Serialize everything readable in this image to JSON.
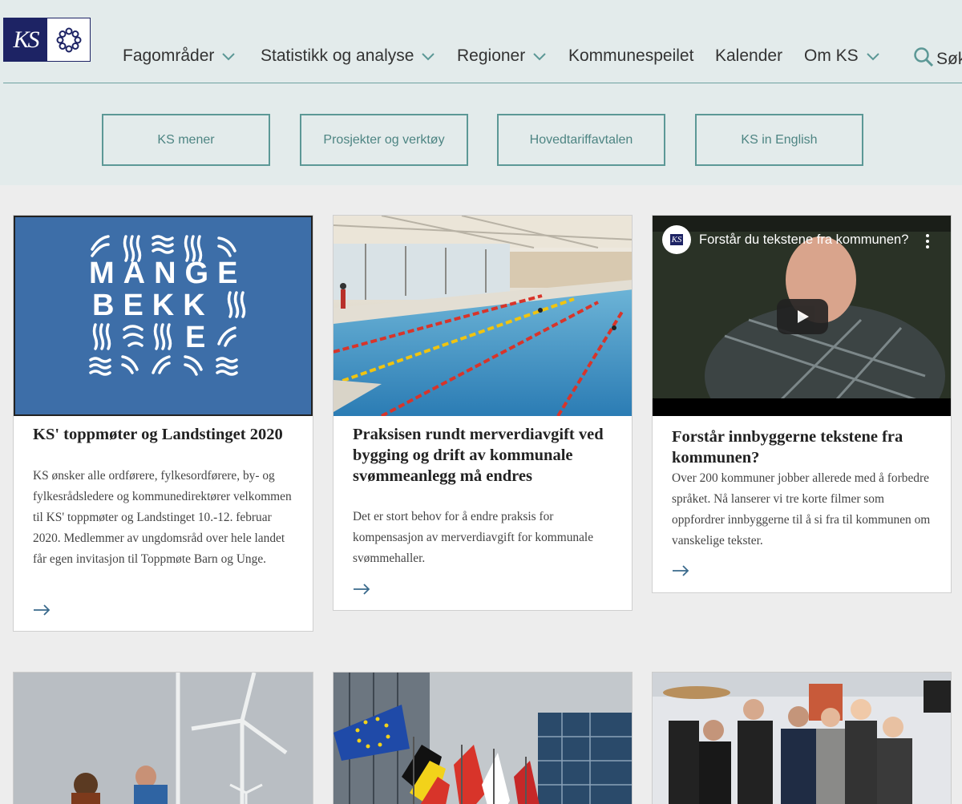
{
  "header": {
    "logo_text": "KS",
    "nav": [
      {
        "label": "Fagområder",
        "has_dropdown": true
      },
      {
        "label": "Statistikk og analyse",
        "has_dropdown": true
      },
      {
        "label": "Regioner",
        "has_dropdown": true
      },
      {
        "label": "Kommunespeilet",
        "has_dropdown": false
      },
      {
        "label": "Kalender",
        "has_dropdown": false
      },
      {
        "label": "Om KS",
        "has_dropdown": true
      }
    ],
    "search_label": "Søk",
    "quick_links": [
      "KS mener",
      "Prosjekter og verktøy",
      "Hovedtariffavtalen",
      "KS in English"
    ]
  },
  "cards": [
    {
      "image_text": [
        "MANGE",
        "BEKK",
        "E"
      ],
      "title": "KS' toppmøter og Landstinget 2020",
      "text": "KS ønsker alle ordførere, fylkesordførere, by- og fylkesrådsledere og kommunedirektører velkommen til KS' toppmøter og Landstinget 10.-12. februar 2020. Medlemmer av ungdomsråd over hele landet får egen invitasjon til Toppmøte Barn og Unge."
    },
    {
      "title": "Praksisen rundt merverdiavgift ved bygging og drift av kommunale svømmeanlegg må endres",
      "text": "Det er stort behov for å endre praksis for kompensasjon av merverdiavgift for kommunale svømmehaller."
    },
    {
      "video_title": "Forstår du tekstene fra kommunen?",
      "video_logo": "KS",
      "title": "Forstår innbyggerne tekstene fra kommunen?",
      "text": "Over 200 kommuner jobber allerede med å forbedre språket. Nå lanserer vi tre korte filmer som oppfordrer innbyggerne til å si fra til kommunen om vanskelige tekster."
    }
  ],
  "colors": {
    "header_bg": "#e3ebeb",
    "accent": "#5c9896",
    "brand_navy": "#1d2364",
    "mange_bekke_blue": "#3d6ea8",
    "arrow": "#3a6a8c"
  },
  "icons": {
    "search": "search-icon",
    "chevron": "chevron-down-icon",
    "arrow": "arrow-right-icon",
    "play": "play-icon",
    "more": "more-vertical-icon"
  }
}
